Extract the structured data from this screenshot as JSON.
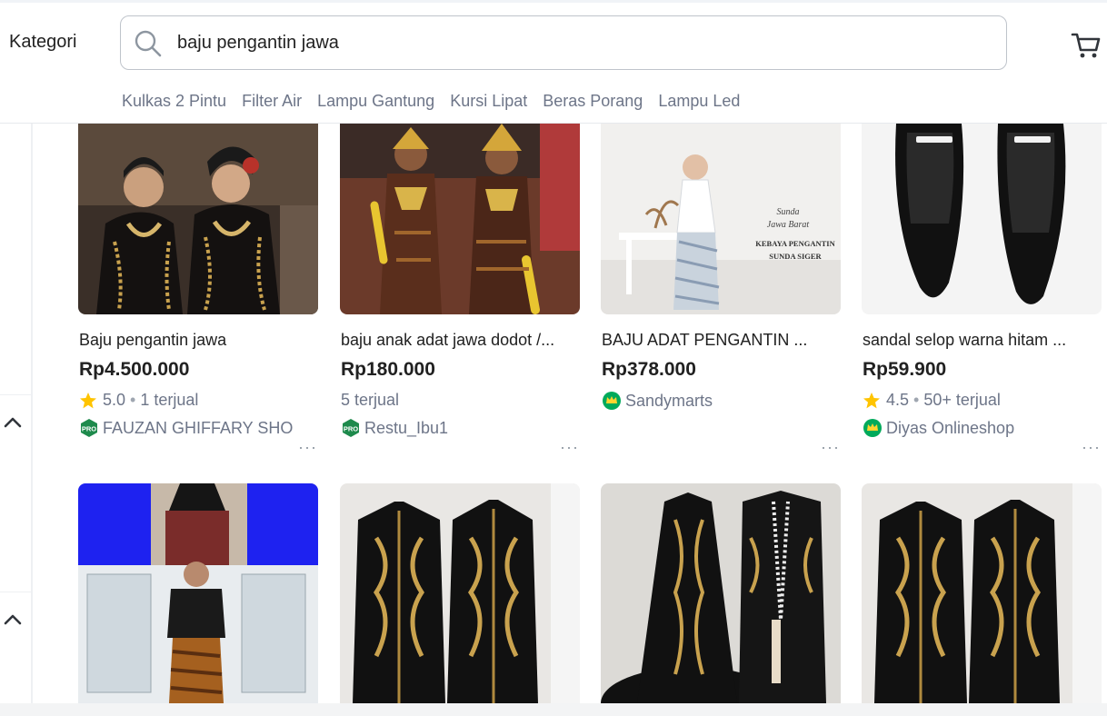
{
  "header": {
    "kategori_label": "Kategori",
    "search_value": "baju pengantin jawa",
    "search_icon": "search-icon",
    "cart_icon": "cart-icon"
  },
  "suggestions": [
    "Kulkas 2 Pintu",
    "Filter Air",
    "Lampu Gantung",
    "Kursi Lipat",
    "Beras Porang",
    "Lampu Led"
  ],
  "products": [
    {
      "title": "Baju pengantin jawa",
      "price": "Rp4.500.000",
      "rating": "5.0",
      "sold": "1 terjual",
      "shop": "FAUZAN GHIFFARY SHO",
      "badge": "pro-badge"
    },
    {
      "title": "baju anak adat jawa dodot /...",
      "price": "Rp180.000",
      "rating": "",
      "sold": "5 terjual",
      "shop": "Restu_Ibu1",
      "badge": "pro-badge"
    },
    {
      "title": "BAJU ADAT PENGANTIN ...",
      "price": "Rp378.000",
      "rating": "",
      "sold": "",
      "shop": "Sandymarts",
      "badge": "official-store-badge"
    },
    {
      "title": "sandal selop warna hitam ...",
      "price": "Rp59.900",
      "rating": "4.5",
      "sold": "50+ terjual",
      "shop": "Diyas Onlineshop",
      "badge": "official-store-badge"
    }
  ],
  "image_overlay_texts": {
    "kebaya_line1": "Sunda",
    "kebaya_line2": "Jawa Barat",
    "kebaya_line3": "KEBAYA PENGANTIN",
    "kebaya_line4": "SUNDA SIGER"
  },
  "colors": {
    "text_primary": "#212121",
    "text_secondary": "#6d7588",
    "star": "#ffc400",
    "pro_badge": "#1e8a4c",
    "os_badge": "#00aa5b"
  }
}
